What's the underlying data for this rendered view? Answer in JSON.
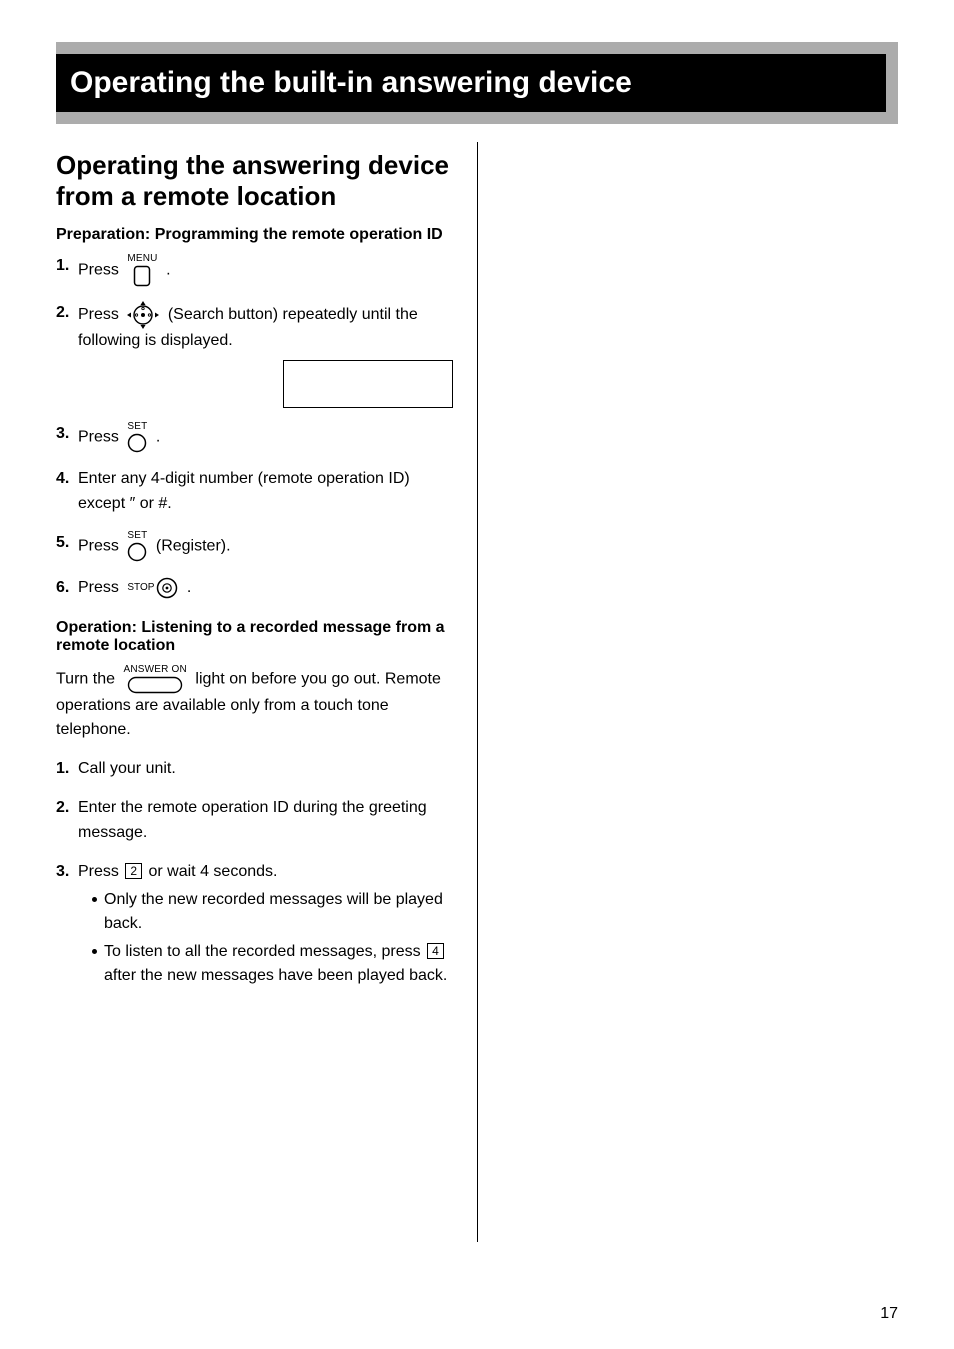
{
  "title_bar": "Operating the built-in answering device",
  "section_heading_line1": "Operating the answering device",
  "section_heading_line2": "from a remote location",
  "prep": {
    "heading": "Preparation: Programming the remote operation ID",
    "steps": {
      "s1_num": "1.",
      "s1_a": "Press",
      "s1_b": ".",
      "icon_menu_label": "MENU",
      "s2_num": "2.",
      "s2_a": "Press",
      "s2_b": "(Search button) repeatedly until the following is displayed.",
      "s3_num": "3.",
      "s3_a": "Press",
      "s3_b": ".",
      "icon_set_label": "SET",
      "s4_num": "4.",
      "s4_text": "Enter any 4-digit number (remote operation ID) except ″ or #.",
      "s5_num": "5.",
      "s5_a": "Press",
      "s5_b": "(Register).",
      "s6_num": "6.",
      "s6_a": "Press",
      "s6_b": ".",
      "icon_stop_label": "STOP"
    }
  },
  "op": {
    "heading": "Operation: Listening to a recorded message from a remote location",
    "intro_a": "Turn the",
    "icon_answer_label": "ANSWER ON",
    "intro_b": "light on before you go out. Remote operations are available only from a touch tone telephone.",
    "steps": {
      "s1_num": "1.",
      "s1_text": "Call your unit.",
      "s2_num": "2.",
      "s2_text": "Enter the remote operation ID during the greeting message.",
      "s3_num": "3.",
      "s3_a": "Press",
      "s3_key2": "2",
      "s3_b": "or wait 4 seconds.",
      "s3_sub1": "Only the new recorded messages will be played back.",
      "s3_sub2_a": "To listen to all the recorded messages, press",
      "s3_key4": "4",
      "s3_sub2_b": "after the new messages have been played back."
    }
  },
  "page_number": "17"
}
